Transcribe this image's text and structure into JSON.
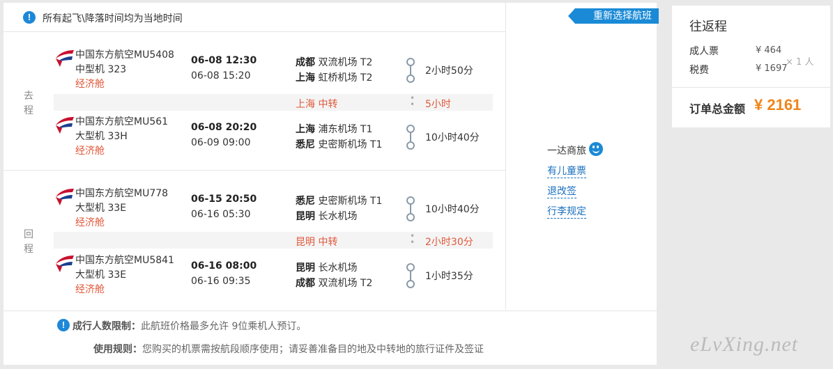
{
  "notice": {
    "icon": "info-icon",
    "text": "所有起飞\\降落时间均为当地时间"
  },
  "rebook_label": "重新选择航班",
  "outbound": {
    "label": "去程",
    "flights": [
      {
        "airline": "中国东方航空MU5408",
        "plane": "中型机 323",
        "cabin": "经济舱",
        "depart": "06-08 12:30",
        "arrive": "06-08 15:20",
        "from_city": "成都",
        "from_airport": "双流机场 T2",
        "to_city": "上海",
        "to_airport": "虹桥机场 T2",
        "duration": "2小时50分"
      },
      {
        "airline": "中国东方航空MU561",
        "plane": "大型机 33H",
        "cabin": "经济舱",
        "depart": "06-08 20:20",
        "arrive": "06-09 09:00",
        "from_city": "上海",
        "from_airport": "浦东机场 T1",
        "to_city": "悉尼",
        "to_airport": "史密斯机场 T1",
        "duration": "10小时40分"
      }
    ],
    "transfer": {
      "city": "上海 中转",
      "wait": "5小时"
    }
  },
  "return": {
    "label": "回程",
    "flights": [
      {
        "airline": "中国东方航空MU778",
        "plane": "大型机 33E",
        "cabin": "经济舱",
        "depart": "06-15 20:50",
        "arrive": "06-16 05:30",
        "from_city": "悉尼",
        "from_airport": "史密斯机场 T1",
        "to_city": "昆明",
        "to_airport": "长水机场",
        "duration": "10小时40分"
      },
      {
        "airline": "中国东方航空MU5841",
        "plane": "大型机 33E",
        "cabin": "经济舱",
        "depart": "06-16 08:00",
        "arrive": "06-16 09:35",
        "from_city": "昆明",
        "from_airport": "长水机场",
        "to_city": "成都",
        "to_airport": "双流机场 T2",
        "duration": "1小时35分"
      }
    ],
    "transfer": {
      "city": "昆明 中转",
      "wait": "2小时30分"
    }
  },
  "service": {
    "brand": "一达商旅",
    "links": [
      "有儿童票",
      "退改签",
      "行李规定"
    ]
  },
  "footer": {
    "limit_label": "成行人数限制：",
    "limit_text": "此航班价格最多允许 9位乘机人预订。",
    "rule_label": "使用规则：",
    "rule_text": "您购买的机票需按航段顺序使用；请妥善准备目的地及中转地的旅行证件及签证"
  },
  "summary": {
    "title": "往返程",
    "adult_label": "成人票",
    "adult_price": "¥ 464",
    "tax_label": "税费",
    "tax_price": "¥ 1697",
    "multiplier": "× 1 人",
    "total_label": "订单总金额",
    "total_value": "¥ 2161"
  },
  "watermark": "eLvXing.net",
  "colors": {
    "accent_blue": "#1a8ad6",
    "cabin_red": "#e0583a",
    "total_orange": "#f08519"
  }
}
